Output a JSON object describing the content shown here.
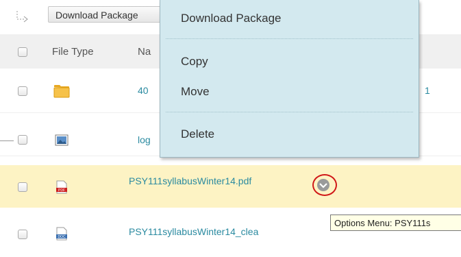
{
  "toolbar": {
    "download_label": "Download Package"
  },
  "header": {
    "file_type": "File Type",
    "name": "Na"
  },
  "rows": [
    {
      "name": "40",
      "trailing": "1",
      "type": "folder"
    },
    {
      "name": "log",
      "type": "image"
    },
    {
      "name": "PSY111syllabusWinter14.pdf",
      "type": "pdf",
      "icon_text": "PDF"
    },
    {
      "name": "PSY111syllabusWinter14_clea",
      "type": "doc",
      "icon_text": "DOC"
    }
  ],
  "menu": {
    "items": [
      "Download Package",
      "Copy",
      "Move",
      "Delete"
    ]
  },
  "tooltip": "Options Menu: PSY111s",
  "colors": {
    "menu_bg": "#d3e9ef",
    "highlight": "#fdf3c4",
    "link": "#2a8aa0",
    "annotation": "#d01818"
  }
}
